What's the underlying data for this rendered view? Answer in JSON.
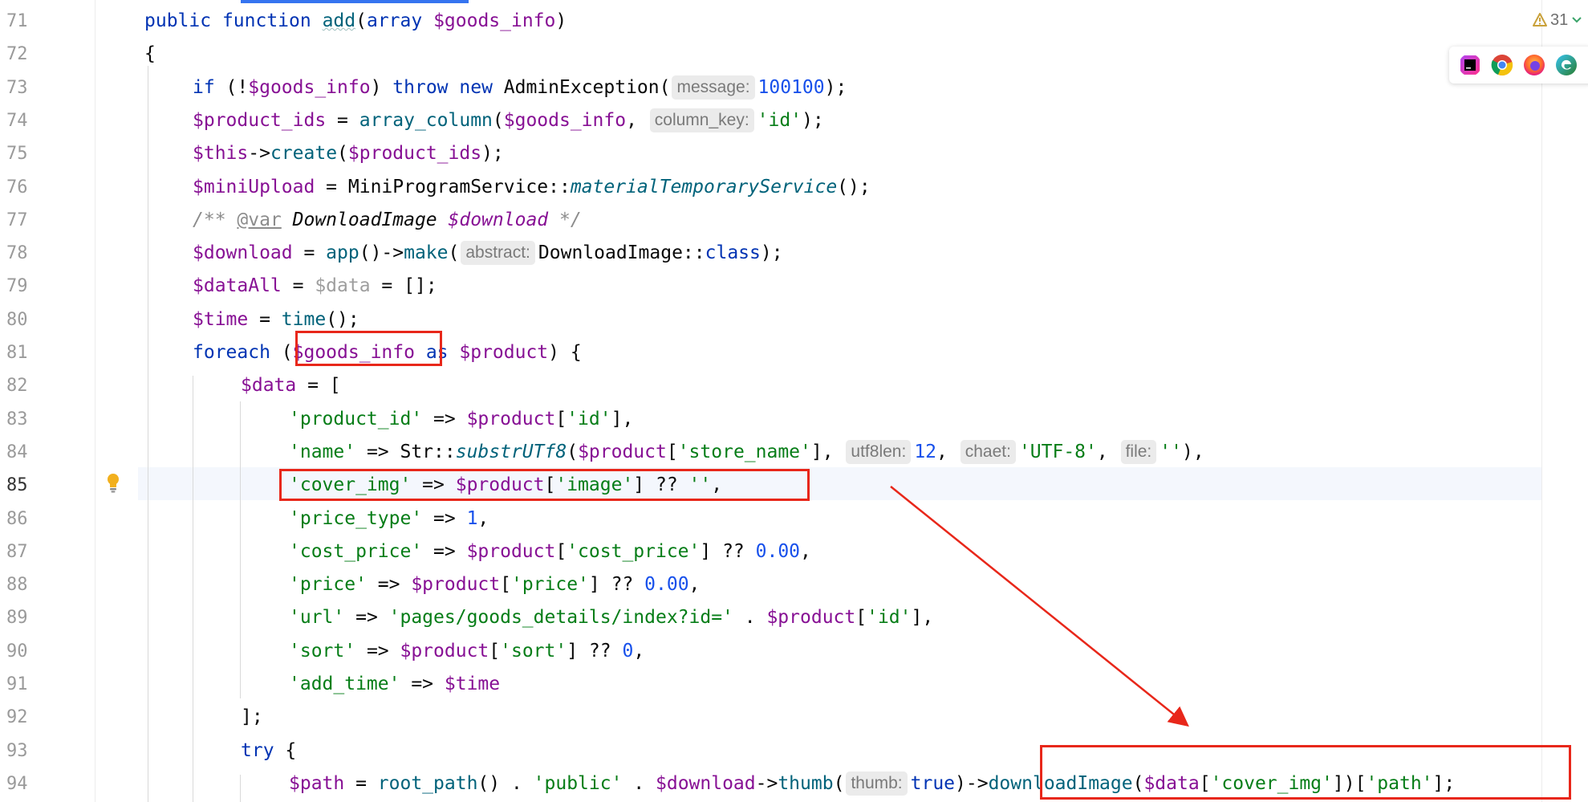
{
  "editor": {
    "inspections": {
      "count": "31"
    },
    "browsers": [
      "phpstorm-icon",
      "chrome-icon",
      "firefox-icon",
      "edge-icon"
    ],
    "lines": [
      {
        "num": "71",
        "indent": 1,
        "tokens": [
          {
            "t": "public ",
            "c": "kw"
          },
          {
            "t": "function ",
            "c": "kw"
          },
          {
            "t": "add",
            "c": "fn wavy"
          },
          {
            "t": "(",
            "c": ""
          },
          {
            "t": "array ",
            "c": "kw"
          },
          {
            "t": "$goods_info",
            "c": "var"
          },
          {
            "t": ")",
            "c": ""
          }
        ]
      },
      {
        "num": "72",
        "indent": 1,
        "tokens": [
          {
            "t": "{",
            "c": ""
          }
        ]
      },
      {
        "num": "73",
        "indent": 2,
        "tokens": [
          {
            "t": "if ",
            "c": "kw"
          },
          {
            "t": "(!",
            "c": ""
          },
          {
            "t": "$goods_info",
            "c": "var"
          },
          {
            "t": ") ",
            "c": ""
          },
          {
            "t": "throw ",
            "c": "kw"
          },
          {
            "t": "new ",
            "c": "kw"
          },
          {
            "t": "AdminException(",
            "c": ""
          },
          {
            "t": "message:",
            "c": "hint"
          },
          {
            "t": "100100",
            "c": "num"
          },
          {
            "t": ");",
            "c": ""
          }
        ]
      },
      {
        "num": "74",
        "indent": 2,
        "tokens": [
          {
            "t": "$product_ids",
            "c": "var"
          },
          {
            "t": " = ",
            "c": ""
          },
          {
            "t": "array_column",
            "c": "fn"
          },
          {
            "t": "(",
            "c": ""
          },
          {
            "t": "$goods_info",
            "c": "var"
          },
          {
            "t": ", ",
            "c": ""
          },
          {
            "t": "column_key:",
            "c": "hint"
          },
          {
            "t": "'id'",
            "c": "str"
          },
          {
            "t": ");",
            "c": ""
          }
        ]
      },
      {
        "num": "75",
        "indent": 2,
        "tokens": [
          {
            "t": "$this",
            "c": "var"
          },
          {
            "t": "->",
            "c": ""
          },
          {
            "t": "create",
            "c": "fn"
          },
          {
            "t": "(",
            "c": ""
          },
          {
            "t": "$product_ids",
            "c": "var"
          },
          {
            "t": ");",
            "c": ""
          }
        ]
      },
      {
        "num": "76",
        "indent": 2,
        "tokens": [
          {
            "t": "$miniUpload",
            "c": "var"
          },
          {
            "t": " = MiniProgramService::",
            "c": ""
          },
          {
            "t": "materialTemporaryService",
            "c": "static"
          },
          {
            "t": "();",
            "c": ""
          }
        ]
      },
      {
        "num": "77",
        "indent": 2,
        "tokens": [
          {
            "t": "/** ",
            "c": "cmt"
          },
          {
            "t": "@var",
            "c": "doctag"
          },
          {
            "t": " ",
            "c": "cmt"
          },
          {
            "t": "DownloadImage",
            "c": "doctype"
          },
          {
            "t": " ",
            "c": "cmt"
          },
          {
            "t": "$download",
            "c": "dvar"
          },
          {
            "t": " */",
            "c": "cmt"
          }
        ]
      },
      {
        "num": "78",
        "indent": 2,
        "tokens": [
          {
            "t": "$download",
            "c": "var"
          },
          {
            "t": " = ",
            "c": ""
          },
          {
            "t": "app",
            "c": "fn"
          },
          {
            "t": "()->",
            "c": ""
          },
          {
            "t": "make",
            "c": "fn"
          },
          {
            "t": "(",
            "c": ""
          },
          {
            "t": "abstract:",
            "c": "hint"
          },
          {
            "t": "DownloadImage::",
            "c": ""
          },
          {
            "t": "class",
            "c": "kw"
          },
          {
            "t": ");",
            "c": ""
          }
        ]
      },
      {
        "num": "79",
        "indent": 2,
        "tokens": [
          {
            "t": "$dataAll",
            "c": "var"
          },
          {
            "t": " = ",
            "c": ""
          },
          {
            "t": "$data",
            "c": "unused"
          },
          {
            "t": " = [];",
            "c": ""
          }
        ]
      },
      {
        "num": "80",
        "indent": 2,
        "tokens": [
          {
            "t": "$time",
            "c": "var"
          },
          {
            "t": " = ",
            "c": ""
          },
          {
            "t": "time",
            "c": "fn"
          },
          {
            "t": "();",
            "c": ""
          }
        ]
      },
      {
        "num": "81",
        "indent": 2,
        "tokens": [
          {
            "t": "foreach ",
            "c": "kw"
          },
          {
            "t": "(",
            "c": ""
          },
          {
            "t": "$goods_info",
            "c": "var"
          },
          {
            "t": " ",
            "c": ""
          },
          {
            "t": "as ",
            "c": "kw"
          },
          {
            "t": "$product",
            "c": "var"
          },
          {
            "t": ") {",
            "c": ""
          }
        ]
      },
      {
        "num": "82",
        "indent": 3,
        "tokens": [
          {
            "t": "$data",
            "c": "var"
          },
          {
            "t": " = [",
            "c": ""
          }
        ]
      },
      {
        "num": "83",
        "indent": 4,
        "tokens": [
          {
            "t": "'product_id'",
            "c": "str"
          },
          {
            "t": " => ",
            "c": ""
          },
          {
            "t": "$product",
            "c": "var"
          },
          {
            "t": "[",
            "c": ""
          },
          {
            "t": "'id'",
            "c": "str"
          },
          {
            "t": "],",
            "c": ""
          }
        ]
      },
      {
        "num": "84",
        "indent": 4,
        "tokens": [
          {
            "t": "'name'",
            "c": "str"
          },
          {
            "t": " => Str::",
            "c": ""
          },
          {
            "t": "substrUTf8",
            "c": "static"
          },
          {
            "t": "(",
            "c": ""
          },
          {
            "t": "$product",
            "c": "var"
          },
          {
            "t": "[",
            "c": ""
          },
          {
            "t": "'store_name'",
            "c": "str"
          },
          {
            "t": "], ",
            "c": ""
          },
          {
            "t": "utf8len:",
            "c": "hint"
          },
          {
            "t": "12",
            "c": "num"
          },
          {
            "t": ", ",
            "c": ""
          },
          {
            "t": "chaet:",
            "c": "hint"
          },
          {
            "t": "'UTF-8'",
            "c": "str"
          },
          {
            "t": ", ",
            "c": ""
          },
          {
            "t": "file:",
            "c": "hint"
          },
          {
            "t": "''",
            "c": "str"
          },
          {
            "t": "),",
            "c": ""
          }
        ]
      },
      {
        "num": "85",
        "indent": 4,
        "tokens": [
          {
            "t": "'cover_img'",
            "c": "str"
          },
          {
            "t": " => ",
            "c": ""
          },
          {
            "t": "$product",
            "c": "var"
          },
          {
            "t": "[",
            "c": ""
          },
          {
            "t": "'image'",
            "c": "str"
          },
          {
            "t": "] ?? ",
            "c": ""
          },
          {
            "t": "''",
            "c": "str"
          },
          {
            "t": ",",
            "c": ""
          }
        ]
      },
      {
        "num": "86",
        "indent": 4,
        "tokens": [
          {
            "t": "'price_type'",
            "c": "str"
          },
          {
            "t": " => ",
            "c": ""
          },
          {
            "t": "1",
            "c": "num"
          },
          {
            "t": ",",
            "c": ""
          }
        ]
      },
      {
        "num": "87",
        "indent": 4,
        "tokens": [
          {
            "t": "'cost_price'",
            "c": "str"
          },
          {
            "t": " => ",
            "c": ""
          },
          {
            "t": "$product",
            "c": "var"
          },
          {
            "t": "[",
            "c": ""
          },
          {
            "t": "'cost_price'",
            "c": "str"
          },
          {
            "t": "] ?? ",
            "c": ""
          },
          {
            "t": "0.00",
            "c": "num"
          },
          {
            "t": ",",
            "c": ""
          }
        ]
      },
      {
        "num": "88",
        "indent": 4,
        "tokens": [
          {
            "t": "'price'",
            "c": "str"
          },
          {
            "t": " => ",
            "c": ""
          },
          {
            "t": "$product",
            "c": "var"
          },
          {
            "t": "[",
            "c": ""
          },
          {
            "t": "'price'",
            "c": "str"
          },
          {
            "t": "] ?? ",
            "c": ""
          },
          {
            "t": "0.00",
            "c": "num"
          },
          {
            "t": ",",
            "c": ""
          }
        ]
      },
      {
        "num": "89",
        "indent": 4,
        "tokens": [
          {
            "t": "'url'",
            "c": "str"
          },
          {
            "t": " => ",
            "c": ""
          },
          {
            "t": "'pages/goods_details/index?id='",
            "c": "str"
          },
          {
            "t": " . ",
            "c": ""
          },
          {
            "t": "$product",
            "c": "var"
          },
          {
            "t": "[",
            "c": ""
          },
          {
            "t": "'id'",
            "c": "str"
          },
          {
            "t": "],",
            "c": ""
          }
        ]
      },
      {
        "num": "90",
        "indent": 4,
        "tokens": [
          {
            "t": "'sort'",
            "c": "str"
          },
          {
            "t": " => ",
            "c": ""
          },
          {
            "t": "$product",
            "c": "var"
          },
          {
            "t": "[",
            "c": ""
          },
          {
            "t": "'sort'",
            "c": "str"
          },
          {
            "t": "] ?? ",
            "c": ""
          },
          {
            "t": "0",
            "c": "num"
          },
          {
            "t": ",",
            "c": ""
          }
        ]
      },
      {
        "num": "91",
        "indent": 4,
        "tokens": [
          {
            "t": "'add_time'",
            "c": "str"
          },
          {
            "t": " => ",
            "c": ""
          },
          {
            "t": "$time",
            "c": "var"
          }
        ]
      },
      {
        "num": "92",
        "indent": 3,
        "tokens": [
          {
            "t": "];",
            "c": ""
          }
        ]
      },
      {
        "num": "93",
        "indent": 3,
        "tokens": [
          {
            "t": "try ",
            "c": "kw"
          },
          {
            "t": "{",
            "c": ""
          }
        ]
      },
      {
        "num": "94",
        "indent": 4,
        "tokens": [
          {
            "t": "$path",
            "c": "var"
          },
          {
            "t": " = ",
            "c": ""
          },
          {
            "t": "root_path",
            "c": "fn"
          },
          {
            "t": "() . ",
            "c": ""
          },
          {
            "t": "'public'",
            "c": "str"
          },
          {
            "t": " . ",
            "c": ""
          },
          {
            "t": "$download",
            "c": "var"
          },
          {
            "t": "->",
            "c": ""
          },
          {
            "t": "thumb",
            "c": "fn"
          },
          {
            "t": "(",
            "c": ""
          },
          {
            "t": "thumb:",
            "c": "hint"
          },
          {
            "t": "true",
            "c": "kw"
          },
          {
            "t": ")->",
            "c": ""
          },
          {
            "t": "downloadImage",
            "c": "fn"
          },
          {
            "t": "(",
            "c": ""
          },
          {
            "t": "$data",
            "c": "var"
          },
          {
            "t": "[",
            "c": ""
          },
          {
            "t": "'cover_img'",
            "c": "str"
          },
          {
            "t": "])[",
            "c": ""
          },
          {
            "t": "'path'",
            "c": "str"
          },
          {
            "t": "];",
            "c": ""
          }
        ]
      }
    ]
  }
}
